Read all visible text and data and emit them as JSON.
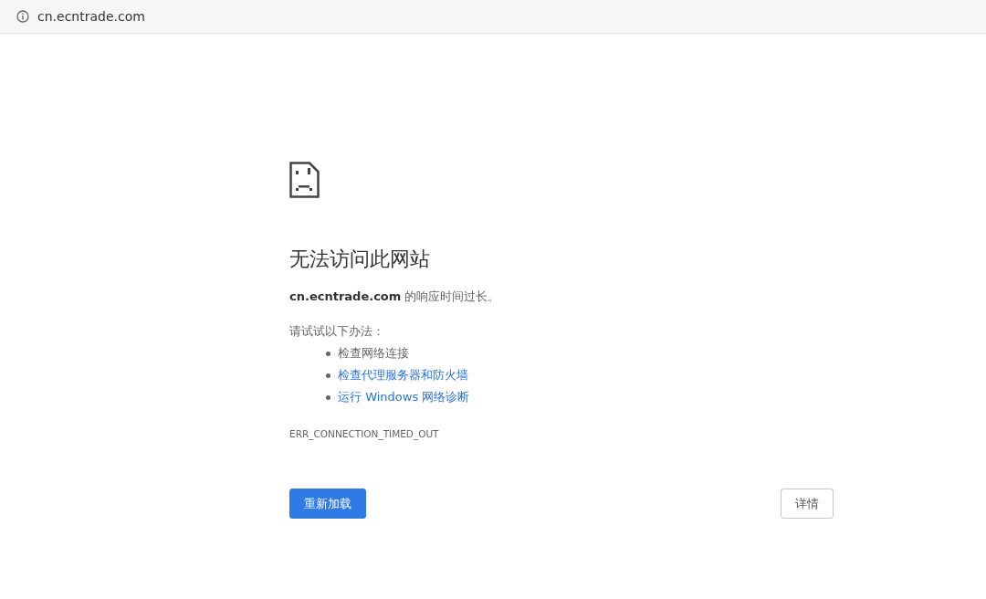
{
  "address_bar": {
    "url": "cn.ecntrade.com"
  },
  "error": {
    "title": "无法访问此网站",
    "message": "**cn.ecntrade.com** 的响应时间过长。",
    "suggestions_heading": "请试试以下办法：",
    "suggestions": [
      {
        "kind": "text",
        "label": "检查网络连接"
      },
      {
        "kind": "link",
        "label": "检查代理服务器和防火墙"
      },
      {
        "kind": "link",
        "label": "运行 Windows 网络诊断"
      }
    ],
    "code": "ERR_CONNECTION_TIMED_OUT"
  },
  "buttons": {
    "reload": "重新加载",
    "details": "详情"
  }
}
